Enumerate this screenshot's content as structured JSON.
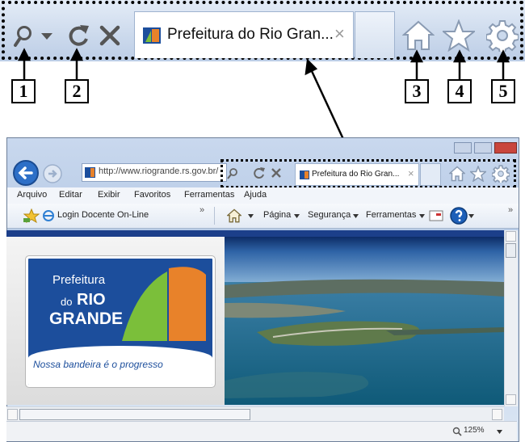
{
  "zoom_toolbar": {
    "tab_title": "Prefeitura do Rio Gran...",
    "close_tab_glyph": "×",
    "callouts": [
      "1",
      "2",
      "3",
      "4",
      "5"
    ],
    "icons": [
      "search-icon",
      "dropdown-arrow-icon",
      "refresh-icon",
      "stop-icon",
      "home-icon",
      "favorites-star-icon",
      "tools-gear-icon"
    ]
  },
  "browser": {
    "address": "http://www.riogrande.rs.gov.br/",
    "tab_title": "Prefeitura do Rio Gran...",
    "close_tab_glyph": "×",
    "menu": [
      "Arquivo",
      "Editar",
      "Exibir",
      "Favoritos",
      "Ferramentas",
      "Ajuda"
    ],
    "favorites_link": "Login Docente On-Line",
    "chevron": "»",
    "command_bar": {
      "page": "Página",
      "safety": "Segurança",
      "tools": "Ferramentas"
    },
    "zoom_level": "125%"
  },
  "site": {
    "logo_line1": "Prefeitura",
    "logo_do": "do",
    "logo_rio": "RIO",
    "logo_grande": "GRANDE",
    "logo_slogan": "Nossa bandeira é o progresso"
  },
  "colors": {
    "accent_blue": "#1c4e9c",
    "orange": "#e8822a",
    "green": "#7bbf3a"
  }
}
